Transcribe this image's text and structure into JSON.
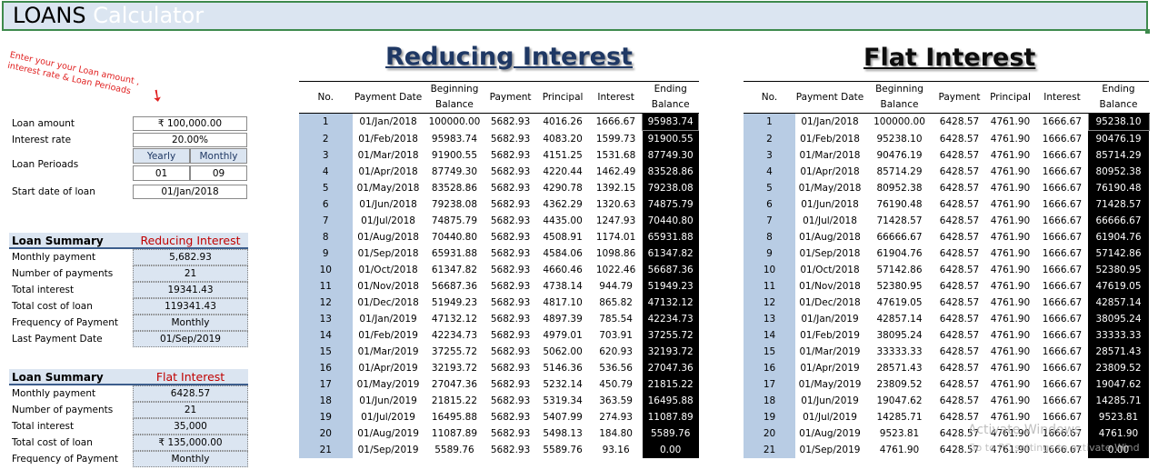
{
  "header": {
    "title_word1": "LOANS",
    "title_word2": "Calculator"
  },
  "hint": {
    "text": "Enter your your Loan amount , interest rate & Loan Perioads",
    "arrow": "➘"
  },
  "titles": {
    "reducing": "Reducing Interest",
    "flat": "Flat Interest"
  },
  "inputs": {
    "loan_amount_label": "Loan amount",
    "loan_amount": "₹ 100,000.00",
    "interest_rate_label": "Interest rate",
    "interest_rate": "20.00%",
    "loan_periods_label": "Loan Perioads",
    "yearly_label": "Yearly",
    "monthly_label": "Monthly",
    "years": "01",
    "months": "09",
    "start_date_label": "Start date of loan",
    "start_date": "01/Jan/2018"
  },
  "summary_reducing": {
    "title": "Loan Summary",
    "type": "Reducing Interest",
    "rows": [
      {
        "label": "Monthly payment",
        "value": "5,682.93"
      },
      {
        "label": "Number of payments",
        "value": "21"
      },
      {
        "label": "Total interest",
        "value": "19341.43"
      },
      {
        "label": "Total cost of loan",
        "value": "119341.43"
      },
      {
        "label": "Frequency of Payment",
        "value": "Monthly"
      },
      {
        "label": "Last Payment Date",
        "value": "01/Sep/2019"
      }
    ]
  },
  "summary_flat": {
    "title": "Loan Summary",
    "type": "Flat Interest",
    "rows": [
      {
        "label": "Monthly payment",
        "value": "6428.57"
      },
      {
        "label": "Number of payments",
        "value": "21"
      },
      {
        "label": "Total interest",
        "value": "35,000"
      },
      {
        "label": "Total cost of loan",
        "value": "₹ 135,000.00"
      },
      {
        "label": "Frequency of Payment",
        "value": "Monthly"
      }
    ]
  },
  "reduce_table": {
    "headers": [
      "No.",
      "Payment Date",
      "Beginning Balance",
      "Payment",
      "Principal",
      "Interest",
      "Ending Balance"
    ],
    "rows": [
      [
        "1",
        "01/Jan/2018",
        "100000.00",
        "5682.93",
        "4016.26",
        "1666.67",
        "95983.74"
      ],
      [
        "2",
        "01/Feb/2018",
        "95983.74",
        "5682.93",
        "4083.20",
        "1599.73",
        "91900.55"
      ],
      [
        "3",
        "01/Mar/2018",
        "91900.55",
        "5682.93",
        "4151.25",
        "1531.68",
        "87749.30"
      ],
      [
        "4",
        "01/Apr/2018",
        "87749.30",
        "5682.93",
        "4220.44",
        "1462.49",
        "83528.86"
      ],
      [
        "5",
        "01/May/2018",
        "83528.86",
        "5682.93",
        "4290.78",
        "1392.15",
        "79238.08"
      ],
      [
        "6",
        "01/Jun/2018",
        "79238.08",
        "5682.93",
        "4362.29",
        "1320.63",
        "74875.79"
      ],
      [
        "7",
        "01/Jul/2018",
        "74875.79",
        "5682.93",
        "4435.00",
        "1247.93",
        "70440.80"
      ],
      [
        "8",
        "01/Aug/2018",
        "70440.80",
        "5682.93",
        "4508.91",
        "1174.01",
        "65931.88"
      ],
      [
        "9",
        "01/Sep/2018",
        "65931.88",
        "5682.93",
        "4584.06",
        "1098.86",
        "61347.82"
      ],
      [
        "10",
        "01/Oct/2018",
        "61347.82",
        "5682.93",
        "4660.46",
        "1022.46",
        "56687.36"
      ],
      [
        "11",
        "01/Nov/2018",
        "56687.36",
        "5682.93",
        "4738.14",
        "944.79",
        "51949.23"
      ],
      [
        "12",
        "01/Dec/2018",
        "51949.23",
        "5682.93",
        "4817.10",
        "865.82",
        "47132.12"
      ],
      [
        "13",
        "01/Jan/2019",
        "47132.12",
        "5682.93",
        "4897.39",
        "785.54",
        "42234.73"
      ],
      [
        "14",
        "01/Feb/2019",
        "42234.73",
        "5682.93",
        "4979.01",
        "703.91",
        "37255.72"
      ],
      [
        "15",
        "01/Mar/2019",
        "37255.72",
        "5682.93",
        "5062.00",
        "620.93",
        "32193.72"
      ],
      [
        "16",
        "01/Apr/2019",
        "32193.72",
        "5682.93",
        "5146.36",
        "536.56",
        "27047.36"
      ],
      [
        "17",
        "01/May/2019",
        "27047.36",
        "5682.93",
        "5232.14",
        "450.79",
        "21815.22"
      ],
      [
        "18",
        "01/Jun/2019",
        "21815.22",
        "5682.93",
        "5319.34",
        "363.59",
        "16495.88"
      ],
      [
        "19",
        "01/Jul/2019",
        "16495.88",
        "5682.93",
        "5407.99",
        "274.93",
        "11087.89"
      ],
      [
        "20",
        "01/Aug/2019",
        "11087.89",
        "5682.93",
        "5498.13",
        "184.80",
        "5589.76"
      ],
      [
        "21",
        "01/Sep/2019",
        "5589.76",
        "5682.93",
        "5589.76",
        "93.16",
        "0.00"
      ]
    ]
  },
  "flat_table": {
    "headers": [
      "No.",
      "Payment Date",
      "Beginning Balance",
      "Payment",
      "Principal",
      "Interest",
      "Ending Balance"
    ],
    "rows": [
      [
        "1",
        "01/Jan/2018",
        "100000.00",
        "6428.57",
        "4761.90",
        "1666.67",
        "95238.10"
      ],
      [
        "2",
        "01/Feb/2018",
        "95238.10",
        "6428.57",
        "4761.90",
        "1666.67",
        "90476.19"
      ],
      [
        "3",
        "01/Mar/2018",
        "90476.19",
        "6428.57",
        "4761.90",
        "1666.67",
        "85714.29"
      ],
      [
        "4",
        "01/Apr/2018",
        "85714.29",
        "6428.57",
        "4761.90",
        "1666.67",
        "80952.38"
      ],
      [
        "5",
        "01/May/2018",
        "80952.38",
        "6428.57",
        "4761.90",
        "1666.67",
        "76190.48"
      ],
      [
        "6",
        "01/Jun/2018",
        "76190.48",
        "6428.57",
        "4761.90",
        "1666.67",
        "71428.57"
      ],
      [
        "7",
        "01/Jul/2018",
        "71428.57",
        "6428.57",
        "4761.90",
        "1666.67",
        "66666.67"
      ],
      [
        "8",
        "01/Aug/2018",
        "66666.67",
        "6428.57",
        "4761.90",
        "1666.67",
        "61904.76"
      ],
      [
        "9",
        "01/Sep/2018",
        "61904.76",
        "6428.57",
        "4761.90",
        "1666.67",
        "57142.86"
      ],
      [
        "10",
        "01/Oct/2018",
        "57142.86",
        "6428.57",
        "4761.90",
        "1666.67",
        "52380.95"
      ],
      [
        "11",
        "01/Nov/2018",
        "52380.95",
        "6428.57",
        "4761.90",
        "1666.67",
        "47619.05"
      ],
      [
        "12",
        "01/Dec/2018",
        "47619.05",
        "6428.57",
        "4761.90",
        "1666.67",
        "42857.14"
      ],
      [
        "13",
        "01/Jan/2019",
        "42857.14",
        "6428.57",
        "4761.90",
        "1666.67",
        "38095.24"
      ],
      [
        "14",
        "01/Feb/2019",
        "38095.24",
        "6428.57",
        "4761.90",
        "1666.67",
        "33333.33"
      ],
      [
        "15",
        "01/Mar/2019",
        "33333.33",
        "6428.57",
        "4761.90",
        "1666.67",
        "28571.43"
      ],
      [
        "16",
        "01/Apr/2019",
        "28571.43",
        "6428.57",
        "4761.90",
        "1666.67",
        "23809.52"
      ],
      [
        "17",
        "01/May/2019",
        "23809.52",
        "6428.57",
        "4761.90",
        "1666.67",
        "19047.62"
      ],
      [
        "18",
        "01/Jun/2019",
        "19047.62",
        "6428.57",
        "4761.90",
        "1666.67",
        "14285.71"
      ],
      [
        "19",
        "01/Jul/2019",
        "14285.71",
        "6428.57",
        "4761.90",
        "1666.67",
        "9523.81"
      ],
      [
        "20",
        "01/Aug/2019",
        "9523.81",
        "6428.57",
        "4761.90",
        "1666.67",
        "4761.90"
      ],
      [
        "21",
        "01/Sep/2019",
        "4761.90",
        "6428.57",
        "4761.90",
        "1666.67",
        "0.00"
      ]
    ]
  },
  "watermark": {
    "line1": "Activate Windows",
    "line2": "Go to PC settings to activate Wind"
  }
}
